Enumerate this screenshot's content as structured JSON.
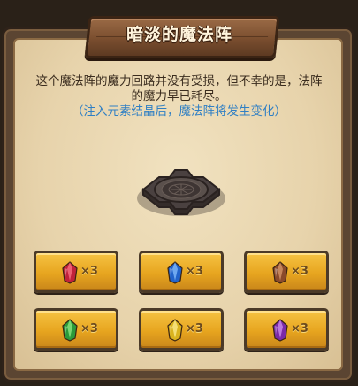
{
  "dialog": {
    "title": "暗淡的魔法阵",
    "description": "这个魔法阵的魔力回路并没有受损，但不幸的是，法阵的魔力早已耗尽。",
    "hint": "（注入元素结晶后，魔法阵将发生变化）"
  },
  "crystals": [
    {
      "name": "red-crystal",
      "color": "#c0213a",
      "light": "#ff7a8a",
      "qty": "×3"
    },
    {
      "name": "blue-crystal",
      "color": "#2263c9",
      "light": "#8fc6ff",
      "qty": "×3"
    },
    {
      "name": "brown-crystal",
      "color": "#8a4a2a",
      "light": "#e0a070",
      "qty": "×3"
    },
    {
      "name": "green-crystal",
      "color": "#2a9a3a",
      "light": "#9af08a",
      "qty": "×3"
    },
    {
      "name": "yellow-crystal",
      "color": "#d9b21e",
      "light": "#fff19a",
      "qty": "×3"
    },
    {
      "name": "purple-crystal",
      "color": "#7a2aa8",
      "light": "#d79af5",
      "qty": "×3"
    }
  ]
}
